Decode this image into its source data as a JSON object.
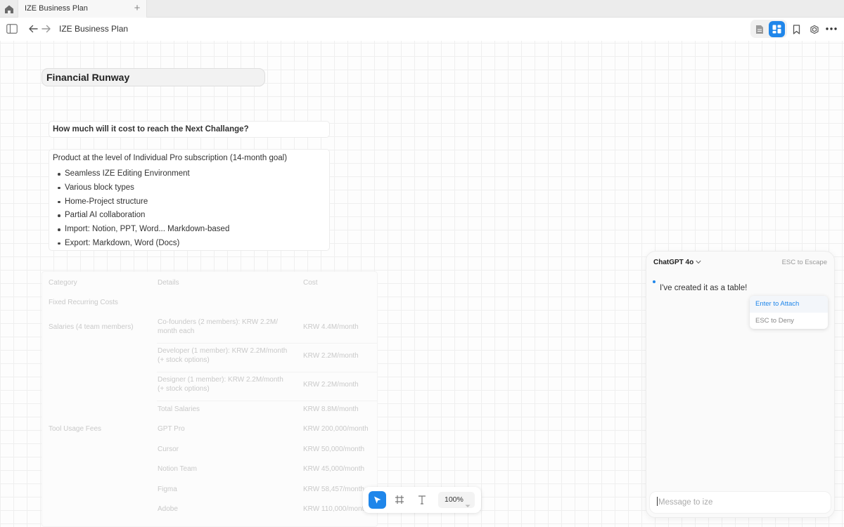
{
  "tabs": [
    {
      "label": "IZE Business Plan",
      "active": true
    }
  ],
  "toolbar": {
    "doc_title": "IZE Business Plan",
    "icons": [
      "sidebar-toggle-icon",
      "back-arrow-icon",
      "forward-arrow-icon",
      "document-view-icon",
      "canvas-view-icon",
      "bookmark-icon",
      "share-icon",
      "more-icon"
    ]
  },
  "canvas": {
    "title": "Financial Runway",
    "question": "How much will it cost to reach the Next Challange?",
    "list_intro": "Product at the level of Individual Pro subscription (14-month goal)",
    "list_items": [
      "Seamless IZE Editing Environment",
      "Various block types",
      "Home-Project structure",
      "Partial AI collaboration",
      "Import: Notion, PPT, Word... Markdown-based",
      "Export: Markdown, Word (Docs)"
    ],
    "table": {
      "headers": [
        "Category",
        "Details",
        "Cost"
      ],
      "rows": [
        {
          "category": "Fixed Recurring Costs",
          "details": "",
          "cost": ""
        },
        {
          "category": "Salaries (4 team members)",
          "details": "Co-founders (2 members): KRW 2.2M/ month each",
          "cost": "KRW 4.4M/month"
        },
        {
          "category": "",
          "details": "Developer (1 member): KRW 2.2M/month (+ stock options)",
          "cost": "KRW 2.2M/month"
        },
        {
          "category": "",
          "details": "Designer (1 member): KRW 2.2M/month (+ stock options)",
          "cost": "KRW 2.2M/month"
        },
        {
          "category": "",
          "details": "Total Salaries",
          "cost": "KRW 8.8M/month"
        },
        {
          "category": "Tool Usage Fees",
          "details": "GPT Pro",
          "cost": "KRW 200,000/month"
        },
        {
          "category": "",
          "details": "Cursor",
          "cost": "KRW 50,000/month"
        },
        {
          "category": "",
          "details": "Notion Team",
          "cost": "KRW 45,000/month"
        },
        {
          "category": "",
          "details": "Figma",
          "cost": "KRW 58,457/month"
        },
        {
          "category": "",
          "details": "Adobe",
          "cost": "KRW 110,000/month"
        }
      ]
    }
  },
  "bottom_toolbar": {
    "zoom": "100%",
    "tools": [
      "pointer-tool-icon",
      "frame-tool-icon",
      "text-tool-icon"
    ]
  },
  "chat": {
    "model": "ChatGPT 4o",
    "escape_hint": "ESC to Escape",
    "message": "I've created it as a table!",
    "attach_option": "Enter to Attach",
    "deny_option": "ESC to Deny",
    "input_placeholder": "Message to ize"
  },
  "colors": {
    "accent": "#1f86ea",
    "tabbar": "#ececec",
    "grid": "#efefef"
  }
}
